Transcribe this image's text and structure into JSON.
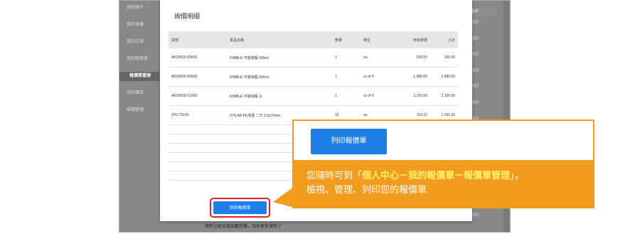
{
  "sidebar": {
    "items": [
      "我的帳戶",
      "我的收藏",
      "我的訂單",
      "我的報價單",
      "報價單管理",
      "合約專區",
      "帳號管理"
    ],
    "active_index": 4
  },
  "right_column": {
    "header": "操作",
    "links": [
      "列印",
      "列印",
      "列印",
      "列印",
      "列印",
      "列印",
      "列印",
      "列印",
      "列印",
      "列印",
      "列印",
      "列印",
      "列印"
    ]
  },
  "bottom_notice": "資料已經全部加載完畢，沒有更多資料了",
  "modal": {
    "title": "詢價明細",
    "columns": [
      "貨號",
      "貨品名稱",
      "數量",
      "單位",
      "未稅單價",
      "小計"
    ],
    "rows": [
      [
        "AK25000-00500",
        "KIMBLE 平底燒瓶 500ml",
        "1",
        "ea",
        "200.00",
        "200.00"
      ],
      [
        "AK26000-00500",
        "KIMBLE 平底燒瓶 500ml",
        "1",
        "cs of 6",
        "1,680.00",
        "1,680.00"
      ],
      [
        "AK26000-01000",
        "KIMBLE 平底燒瓶 1L",
        "1",
        "cs of 6",
        "2,100.00",
        "2,100.00"
      ],
      [
        "Z6V-75193",
        "VITLAB PE洗瓶 二方 9.5x70mm",
        "10",
        "ea",
        "119.10",
        "1,191.00"
      ]
    ],
    "print_button": "列印報價單"
  },
  "callout": {
    "button": "列印報價單",
    "line1_pre": "您隨時可到「",
    "line1_hl": "個人中心－我的報價單－報價單管理",
    "line1_post": "」，",
    "line2": "檢視、管理、列印您的報價單"
  },
  "colors": {
    "accent": "#1e7fe6",
    "callout": "#f29c1f",
    "highlight": "#fff36b",
    "red_frame": "#e02020"
  }
}
